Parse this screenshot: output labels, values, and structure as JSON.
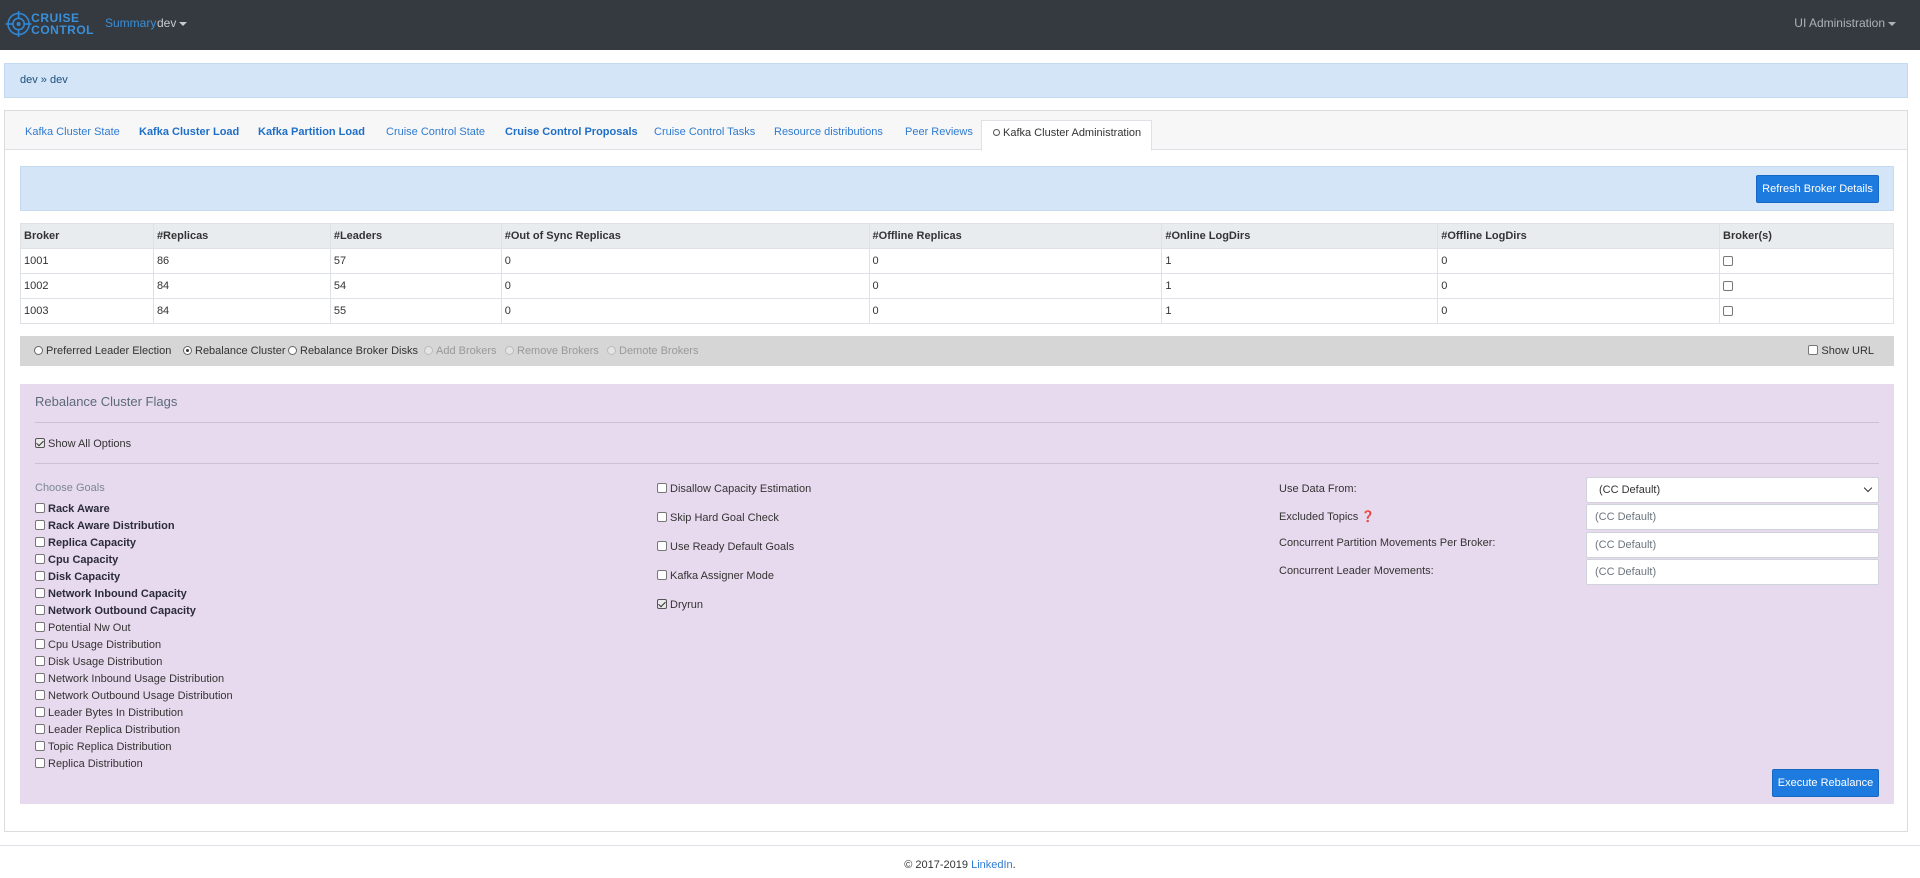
{
  "navbar": {
    "brand_line1": "CRUISE",
    "brand_line2": "CONTROL",
    "summary": "Summary",
    "cluster": "dev",
    "admin": "UI Administration"
  },
  "breadcrumb": "dev » dev",
  "tabs": [
    {
      "label": "Kafka Cluster State"
    },
    {
      "label": "Kafka Cluster Load"
    },
    {
      "label": "Kafka Partition Load"
    },
    {
      "label": "Cruise Control State"
    },
    {
      "label": "Cruise Control Proposals"
    },
    {
      "label": "Cruise Control Tasks"
    },
    {
      "label": "Resource distributions"
    },
    {
      "label": "Peer Reviews"
    },
    {
      "label": "Kafka Cluster Administration"
    }
  ],
  "refresh_button": "Refresh Broker Details",
  "table": {
    "headers": [
      "Broker",
      "#Replicas",
      "#Leaders",
      "#Out of Sync Replicas",
      "#Offline Replicas",
      "#Online LogDirs",
      "#Offline LogDirs",
      "Broker(s)"
    ],
    "rows": [
      [
        "1001",
        "86",
        "57",
        "0",
        "0",
        "1",
        "0"
      ],
      [
        "1002",
        "84",
        "54",
        "0",
        "0",
        "1",
        "0"
      ],
      [
        "1003",
        "84",
        "55",
        "0",
        "0",
        "1",
        "0"
      ]
    ]
  },
  "actions": {
    "preferred": "Preferred Leader Election",
    "rebalance": "Rebalance Cluster",
    "rebalance_disks": "Rebalance Broker Disks",
    "add": "Add Brokers",
    "remove": "Remove Brokers",
    "demote": "Demote Brokers",
    "show_url": "Show URL",
    "selected": "Rebalance Cluster"
  },
  "flags": {
    "title": "Rebalance Cluster Flags",
    "show_all": "Show All Options",
    "choose_goals": "Choose Goals",
    "goals": [
      {
        "label": "Rack Aware",
        "bold": true
      },
      {
        "label": "Rack Aware Distribution",
        "bold": true
      },
      {
        "label": "Replica Capacity",
        "bold": true
      },
      {
        "label": "Cpu Capacity",
        "bold": true
      },
      {
        "label": "Disk Capacity",
        "bold": true
      },
      {
        "label": "Network Inbound Capacity",
        "bold": true
      },
      {
        "label": "Network Outbound Capacity",
        "bold": true
      },
      {
        "label": "Potential Nw Out",
        "bold": false
      },
      {
        "label": "Cpu Usage Distribution",
        "bold": false
      },
      {
        "label": "Disk Usage Distribution",
        "bold": false
      },
      {
        "label": "Network Inbound Usage Distribution",
        "bold": false
      },
      {
        "label": "Network Outbound Usage Distribution",
        "bold": false
      },
      {
        "label": "Leader Bytes In Distribution",
        "bold": false
      },
      {
        "label": "Leader Replica Distribution",
        "bold": false
      },
      {
        "label": "Topic Replica Distribution",
        "bold": false
      },
      {
        "label": "Replica Distribution",
        "bold": false
      }
    ],
    "options": {
      "disallow": "Disallow Capacity Estimation",
      "skip_hard": "Skip Hard Goal Check",
      "ready_default": "Use Ready Default Goals",
      "assigner": "Kafka Assigner Mode",
      "dryrun": "Dryrun"
    },
    "settings": {
      "data_from_label": "Use Data From:",
      "data_from_value": "(CC Default)",
      "excluded_label": "Excluded Topics",
      "excluded_placeholder": "(CC Default)",
      "partition_moves_label": "Concurrent Partition Movements Per Broker:",
      "partition_moves_placeholder": "(CC Default)",
      "leader_moves_label": "Concurrent Leader Movements:",
      "leader_moves_placeholder": "(CC Default)"
    },
    "execute": "Execute Rebalance"
  },
  "footer": {
    "copyright": "© 2017-2019",
    "link": "LinkedIn",
    "period": "."
  },
  "colors": {
    "navbar": "#343a40",
    "accent": "#1d7be0",
    "flags_bg": "#e8daee",
    "info_bg": "#d3e5f7"
  }
}
